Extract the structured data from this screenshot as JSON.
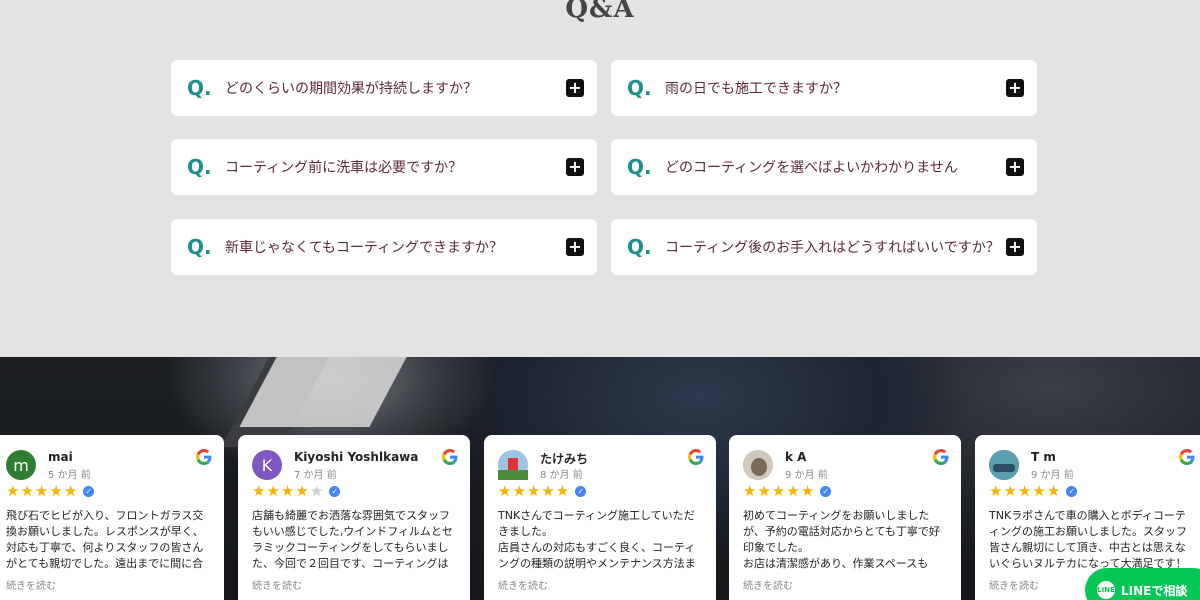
{
  "qa": {
    "title": "Q&A",
    "items": [
      {
        "q": "Q.",
        "text": "どのくらいの期間効果が持続しますか？",
        "toggle": "+"
      },
      {
        "q": "Q.",
        "text": "雨の日でも施工できますか？",
        "toggle": "+"
      },
      {
        "q": "Q.",
        "text": "コーティング前に洗車は必要ですか？",
        "toggle": "+"
      },
      {
        "q": "Q.",
        "text": "どのコーティングを選べばよいかわかりません",
        "toggle": "+"
      },
      {
        "q": "Q.",
        "text": "新車じゃなくてもコーティングできますか？",
        "toggle": "+"
      },
      {
        "q": "Q.",
        "text": "コーティング後のお手入れはどうすればいいですか？",
        "toggle": "+"
      }
    ]
  },
  "reviews": [
    {
      "initial": "m",
      "avatar_color": "#2e7d32",
      "name": "mai",
      "date": "5 か月 前",
      "rating": 5,
      "body": "飛び石でヒビが入り、フロントガラス交換お願いしました。レスポンスが早く、対応も丁寧で、何よりスタッフの皆さんがとても親切でした。遠出までに間に合わせても…",
      "more": "続きを読む"
    },
    {
      "initial": "K",
      "avatar_color": "#7e57c2",
      "name": "Kiyoshi Yoshlkawa",
      "date": "7 か月 前",
      "rating": 4,
      "body": "店舗も綺麗でお洒落な雰囲気でスタッフもいい感じでした,ウインドフィルムとセラミックコーティングをしてもらいました、今回で２回目です、コーティングは初めて…",
      "more": "続きを読む"
    },
    {
      "initial": "",
      "avatar_color": "#8fb7d9",
      "name": "たけみち",
      "date": "8 か月 前",
      "rating": 5,
      "body": "TNKさんでコーティング施工していただきました。\n店員さんの対応もすごく良く、コーティングの種類の説明やメンテナンス方法まで…",
      "more": "続きを読む"
    },
    {
      "initial": "",
      "avatar_color": "#b8b2a6",
      "name": "k A",
      "date": "9 か月 前",
      "rating": 5,
      "body": "初めてコーティングをお願いしましたが、予約の電話対応からとても丁寧で好印象でした。\nお店は清潔感があり、作業スペースも整…",
      "more": "続きを読む"
    },
    {
      "initial": "",
      "avatar_color": "#3f7f8f",
      "name": "T m",
      "date": "9 か月 前",
      "rating": 5,
      "body": "TNKラボさんで車の購入とボディコーティングの施工お願いしました。スタッフ皆さん親切にして頂き、中古とは思えないぐらいヌルテカになって大満足です！今後と…",
      "more": "続きを読む"
    }
  ],
  "line_button": {
    "label": "LINEで相談",
    "icon_text": "LINE"
  },
  "colors": {
    "accent_teal": "#1f8f8a",
    "question_text": "#5a2a3c",
    "star": "#f5b400",
    "line_green": "#06c755"
  },
  "icons": {
    "google": "google-g-icon",
    "verified": "verified-check-icon",
    "plus": "plus-icon"
  }
}
